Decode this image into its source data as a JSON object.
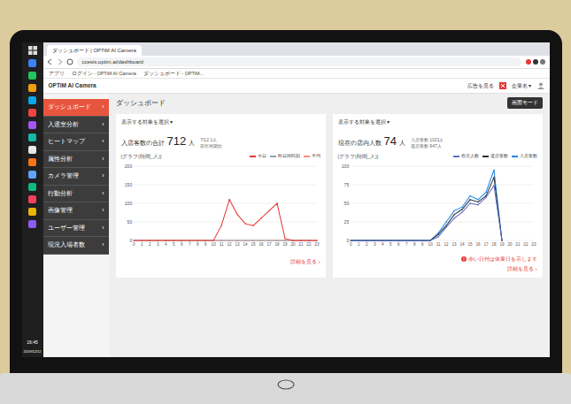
{
  "browser": {
    "tab_title": "ダッシュボード | OPTiM AI Camera",
    "url": "ccesis.optim.ai/dashboard",
    "bookmarks": [
      "アプリ",
      "ログイン - OPTiM AI Camera",
      "ダッシュボード - OPTiM..."
    ]
  },
  "taskbar": {
    "clock": "16:45",
    "date": "2019/12/12"
  },
  "header": {
    "title": "OPTiM AI Camera",
    "notice": "広告を見る",
    "user": "企業名 ▾"
  },
  "sidebar": {
    "items": [
      {
        "label": "ダッシュボード",
        "chevron": "›",
        "selected": true
      },
      {
        "label": "入退室分析",
        "chevron": "›",
        "selected": false
      },
      {
        "label": "ヒートマップ",
        "chevron": "›",
        "selected": false
      },
      {
        "label": "属性分析",
        "chevron": "›",
        "selected": false
      },
      {
        "label": "カメラ管理",
        "chevron": "›",
        "selected": false
      },
      {
        "label": "行動分析",
        "chevron": "›",
        "selected": false
      },
      {
        "label": "画像管理",
        "chevron": "›",
        "selected": false
      },
      {
        "label": "ユーザー管理",
        "chevron": "›",
        "selected": false
      },
      {
        "label": "現況入場者数",
        "chevron": "›",
        "selected": false
      }
    ]
  },
  "page": {
    "heading": "ダッシュボード",
    "button": "画面モード"
  },
  "cards": [
    {
      "selector": "表示する対象を選択 ▾",
      "metric": {
        "label": "入店客数の合計",
        "value": "712",
        "unit": "人"
      },
      "sub": [
        "7/12 1人",
        "前年同期比"
      ],
      "axis_label": "[グラフ(時間_人)]",
      "chart": {
        "ticks": [
          "200",
          "150",
          "100",
          "50",
          "0"
        ],
        "x_labels": [
          "0",
          "1",
          "2",
          "3",
          "4",
          "5",
          "6",
          "7",
          "8",
          "9",
          "10",
          "11",
          "12",
          "13",
          "14",
          "15",
          "16",
          "17",
          "18",
          "19",
          "20",
          "21",
          "22",
          "23"
        ],
        "series": [
          {
            "label": "平均",
            "color": "#ff8a80",
            "values": [
              0,
              0,
              0,
              0,
              0,
              0,
              0,
              0,
              0,
              0,
              0,
              0,
              0,
              0,
              0,
              0,
              0,
              0,
              0,
              0,
              0,
              0,
              0,
              0
            ]
          },
          {
            "label": "昨日同時刻",
            "color": "#90a4ae",
            "values": [
              0,
              0,
              0,
              0,
              0,
              0,
              0,
              0,
              0,
              0,
              0,
              0,
              0,
              0,
              0,
              0,
              0,
              0,
              0,
              0,
              0,
              0,
              0,
              0
            ]
          },
          {
            "label": "今日",
            "color": "#e53935",
            "values": [
              0,
              0,
              0,
              0,
              0,
              0,
              0,
              0,
              0,
              0,
              0,
              40,
              110,
              70,
              45,
              40,
              60,
              80,
              100,
              5,
              0,
              0,
              0,
              0
            ]
          }
        ]
      },
      "notice": "",
      "link": "詳細を見る ›"
    },
    {
      "selector": "表示する対象を選択 ▾",
      "metric": {
        "label": "現在の店内人数",
        "value": "74",
        "unit": "人"
      },
      "sub": [
        "入店客数 1021人",
        "退店客数 947人"
      ],
      "axis_label": "[グラフ(時間_人)]",
      "chart": {
        "ticks": [
          "100",
          "75",
          "50",
          "25",
          "0"
        ],
        "x_labels": [
          "0",
          "1",
          "2",
          "3",
          "4",
          "5",
          "6",
          "7",
          "8",
          "9",
          "10",
          "11",
          "12",
          "13",
          "14",
          "15",
          "16",
          "17",
          "18",
          "19",
          "20",
          "21",
          "22",
          "23"
        ],
        "series": [
          {
            "label": "入店客数",
            "color": "#1e88e5",
            "values": [
              0,
              0,
              0,
              0,
              0,
              0,
              0,
              0,
              0,
              0,
              0,
              10,
              25,
              40,
              45,
              60,
              55,
              65,
              95,
              0
            ]
          },
          {
            "label": "退店客数",
            "color": "#263238",
            "values": [
              0,
              0,
              0,
              0,
              0,
              0,
              0,
              0,
              0,
              0,
              0,
              8,
              20,
              35,
              42,
              55,
              52,
              60,
              85,
              0
            ]
          },
          {
            "label": "在店人数",
            "color": "#5c6bc0",
            "values": [
              0,
              0,
              0,
              0,
              0,
              0,
              0,
              0,
              0,
              0,
              0,
              5,
              18,
              30,
              38,
              50,
              48,
              58,
              74,
              0
            ]
          }
        ]
      },
      "notice": "赤い日付は休業日を示します",
      "link": "詳細を見る ›"
    }
  ]
}
